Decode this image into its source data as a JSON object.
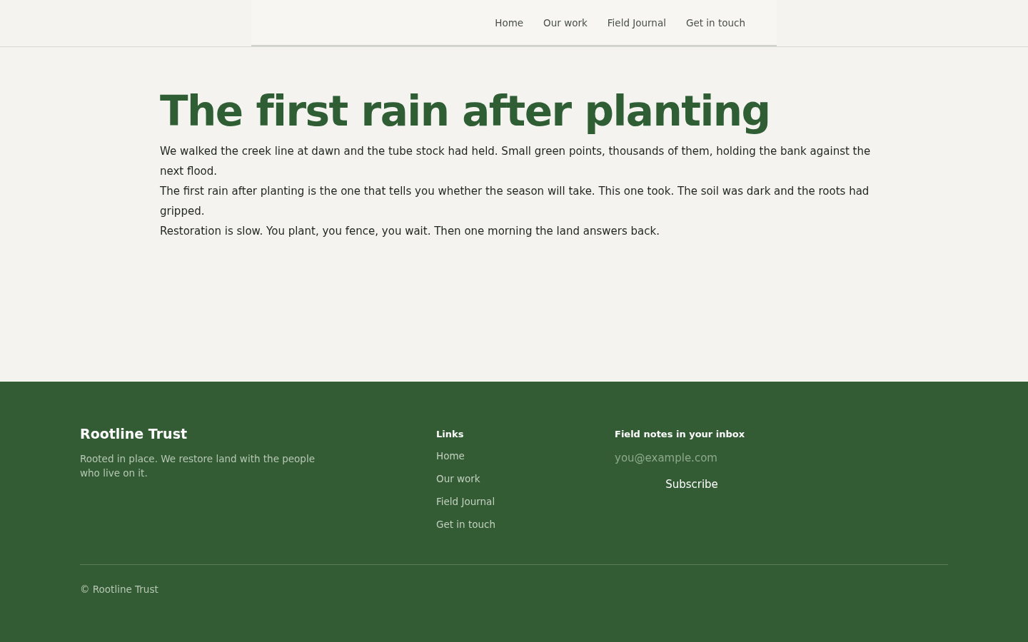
{
  "nav": {
    "links": [
      "Home",
      "Our work",
      "Field Journal",
      "Get in touch"
    ]
  },
  "article": {
    "title": "The first rain after planting",
    "paragraphs": [
      "We walked the creek line at dawn and the tube stock had held. Small green points, thousands of them, holding the bank against the next flood.",
      "The first rain after planting is the one that tells you whether the season will take. This one took. The soil was dark and the roots had gripped.",
      "Restoration is slow. You plant, you fence, you wait. Then one morning the land answers back."
    ]
  },
  "footer": {
    "brand": "Rootline Trust",
    "tagline": "Rooted in place. We restore land with the people who live on it.",
    "links_heading": "Links",
    "links": [
      "Home",
      "Our work",
      "Field Journal",
      "Get in touch"
    ],
    "newsletter_heading": "Field notes in your inbox",
    "email": {
      "placeholder": "you@example.com"
    },
    "subscribe": "Subscribe",
    "copyright": "© Rootline Trust"
  }
}
